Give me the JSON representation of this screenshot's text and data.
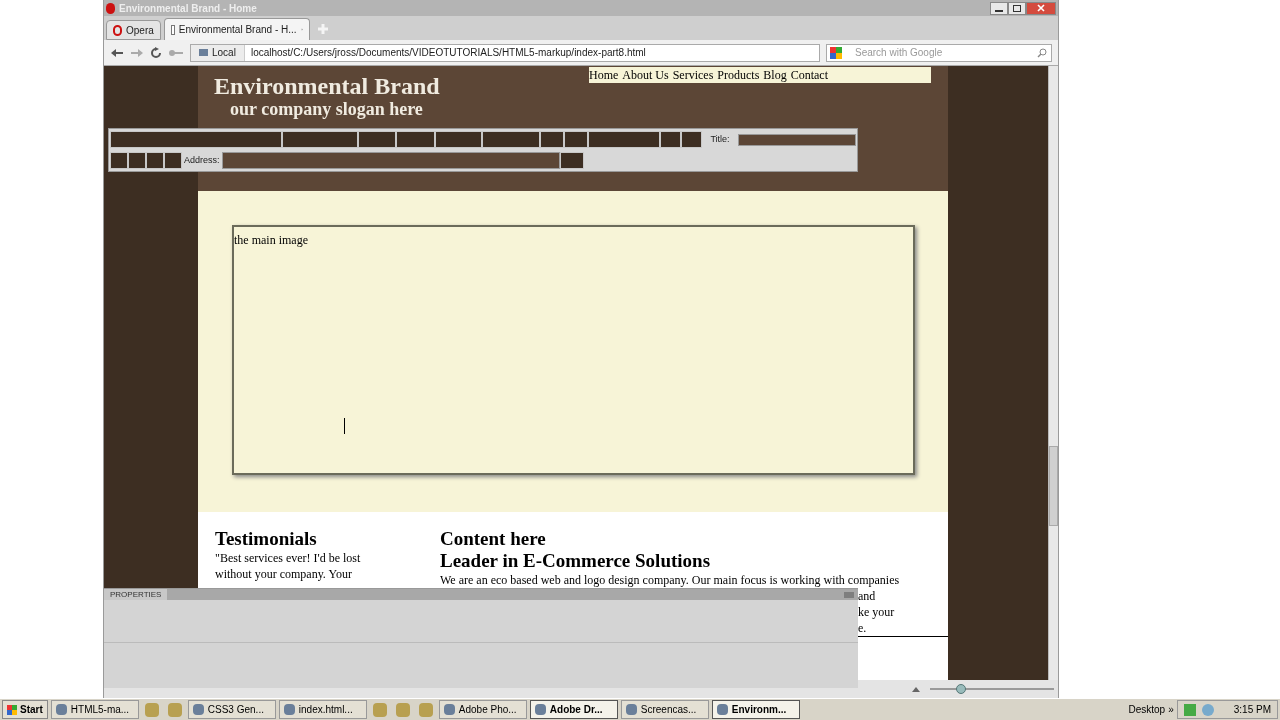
{
  "title_bar": {
    "title": "Environmental Brand - Home"
  },
  "opera_button": {
    "label": "Opera"
  },
  "tabs": [
    {
      "label": "Environmental Brand - H...",
      "selected": true
    }
  ],
  "address_bar": {
    "security_label": "Local",
    "url": "localhost/C:/Users/jross/Documents/VIDEOTUTORIALS/HTML5-markup/index-part8.html",
    "search_placeholder": "Search with Google"
  },
  "page": {
    "brand": "Environmental Brand",
    "slogan": "our company slogan here",
    "nav": [
      "Home",
      "About Us",
      "Services",
      "Products",
      "Blog",
      "Contact"
    ],
    "main_image_label": "the main image",
    "testimonials": {
      "heading": "Testimonials",
      "text": "\"Best services ever! I'd be lost without your company. Your"
    },
    "content": {
      "heading": "Content here",
      "subheading": "Leader in E-Commerce Solutions",
      "text": "We are an eco based web and logo design company. Our main focus is working with companies"
    },
    "fragments": [
      "and",
      "ke your",
      "e."
    ]
  },
  "dw_toolbar": {
    "title_label": "Title:",
    "address_label": "Address:"
  },
  "properties_panel": {
    "title": "PROPERTIES"
  },
  "zoom_slider": {
    "level": 0.25
  },
  "taskbar": {
    "start": "Start",
    "items": [
      {
        "kind": "window",
        "label": "HTML5-ma...",
        "selected": false
      },
      {
        "kind": "launcher"
      },
      {
        "kind": "launcher"
      },
      {
        "kind": "window",
        "label": "CSS3 Gen...",
        "selected": false
      },
      {
        "kind": "window",
        "label": "index.html...",
        "selected": false
      },
      {
        "kind": "launcher"
      },
      {
        "kind": "launcher"
      },
      {
        "kind": "launcher"
      },
      {
        "kind": "window",
        "label": "Adobe Pho...",
        "selected": false
      },
      {
        "kind": "window",
        "label": "Adobe Dr...",
        "selected": true
      },
      {
        "kind": "window",
        "label": "Screencas...",
        "selected": false
      },
      {
        "kind": "window",
        "label": "Environm...",
        "selected": true
      }
    ],
    "desktop": "Desktop",
    "chevron": "»",
    "clock": "3:15 PM"
  }
}
